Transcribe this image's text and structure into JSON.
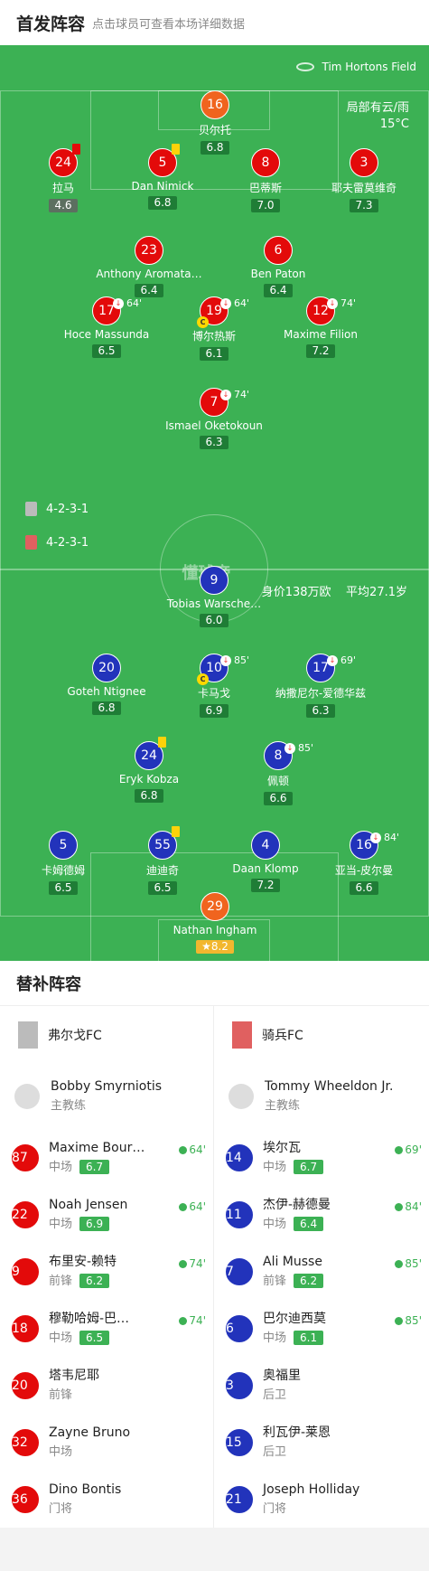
{
  "header": {
    "title": "首发阵容",
    "subtitle": "点击球员可查看本场详细数据"
  },
  "match": {
    "venue": "Tim Hortons Field",
    "weather": "局部有云/雨",
    "temp": "15°C"
  },
  "home": {
    "formation": "4-2-3-1",
    "players": [
      {
        "num": "16",
        "name": "贝尔托",
        "rating": "6.8",
        "gk": true
      },
      {
        "num": "24",
        "name": "拉马",
        "rating": "4.6",
        "card": "red",
        "low": true
      },
      {
        "num": "5",
        "name": "Dan Nimick",
        "rating": "6.8",
        "card": "yellow"
      },
      {
        "num": "8",
        "name": "巴蒂斯",
        "rating": "7.0"
      },
      {
        "num": "3",
        "name": "耶夫雷莫维奇",
        "rating": "7.3"
      },
      {
        "num": "23",
        "name": "Anthony Aromata…",
        "rating": "6.4"
      },
      {
        "num": "6",
        "name": "Ben Paton",
        "rating": "6.4"
      },
      {
        "num": "17",
        "name": "Hoce Massunda",
        "rating": "6.5",
        "sub": "64'"
      },
      {
        "num": "19",
        "name": "博尔热斯",
        "rating": "6.1",
        "sub": "64'",
        "captain": true
      },
      {
        "num": "12",
        "name": "Maxime Filion",
        "rating": "7.2",
        "sub": "74'"
      },
      {
        "num": "7",
        "name": "Ismael Oketokoun",
        "rating": "6.3",
        "sub": "74'"
      }
    ]
  },
  "away": {
    "formation": "4-2-3-1",
    "value": "身价138万欧",
    "age": "平均27.1岁",
    "players": [
      {
        "num": "9",
        "name": "Tobias Warsche…",
        "rating": "6.0"
      },
      {
        "num": "20",
        "name": "Goteh Ntignee",
        "rating": "6.8"
      },
      {
        "num": "10",
        "name": "卡马戈",
        "rating": "6.9",
        "sub": "85'",
        "captain": true
      },
      {
        "num": "17",
        "name": "纳撒尼尔-爱德华兹",
        "rating": "6.3",
        "sub": "69'"
      },
      {
        "num": "24",
        "name": "Eryk Kobza",
        "rating": "6.8",
        "card": "yellow"
      },
      {
        "num": "8",
        "name": "佩顿",
        "rating": "6.6",
        "sub": "85'"
      },
      {
        "num": "5",
        "name": "卡姆德姆",
        "rating": "6.5"
      },
      {
        "num": "55",
        "name": "迪迪奇",
        "rating": "6.5",
        "card": "yellow"
      },
      {
        "num": "4",
        "name": "Daan Klomp",
        "rating": "7.2"
      },
      {
        "num": "16",
        "name": "亚当-皮尔曼",
        "rating": "6.6",
        "sub": "84'"
      },
      {
        "num": "29",
        "name": "Nathan Ingham",
        "rating": "8.2",
        "gk": true,
        "star": true
      }
    ]
  },
  "logo": "懂球帝",
  "subs": {
    "title": "替补阵容",
    "home": {
      "team": "弗尔戈FC",
      "coach": "Bobby Smyrniotis",
      "coach_role": "主教练",
      "list": [
        {
          "num": "87",
          "name": "Maxime Bour…",
          "pos": "中场",
          "rating": "6.7",
          "time": "64'"
        },
        {
          "num": "22",
          "name": "Noah Jensen",
          "pos": "中场",
          "rating": "6.9",
          "time": "64'"
        },
        {
          "num": "9",
          "name": "布里安-赖特",
          "pos": "前锋",
          "rating": "6.2",
          "time": "74'"
        },
        {
          "num": "18",
          "name": "穆勒哈姆-巴…",
          "pos": "中场",
          "rating": "6.5",
          "time": "74'"
        },
        {
          "num": "20",
          "name": "塔韦尼耶",
          "pos": "前锋"
        },
        {
          "num": "32",
          "name": "Zayne Bruno",
          "pos": "中场"
        },
        {
          "num": "36",
          "name": "Dino Bontis",
          "pos": "门将"
        }
      ]
    },
    "away": {
      "team": "骑兵FC",
      "coach": "Tommy Wheeldon Jr.",
      "coach_role": "主教练",
      "list": [
        {
          "num": "14",
          "name": "埃尔瓦",
          "pos": "中场",
          "rating": "6.7",
          "time": "69'"
        },
        {
          "num": "11",
          "name": "杰伊-赫德曼",
          "pos": "中场",
          "rating": "6.4",
          "time": "84'"
        },
        {
          "num": "7",
          "name": "Ali Musse",
          "pos": "前锋",
          "rating": "6.2",
          "time": "85'"
        },
        {
          "num": "6",
          "name": "巴尔迪西莫",
          "pos": "中场",
          "rating": "6.1",
          "time": "85'"
        },
        {
          "num": "3",
          "name": "奥福里",
          "pos": "后卫"
        },
        {
          "num": "15",
          "name": "利瓦伊-莱恩",
          "pos": "后卫"
        },
        {
          "num": "21",
          "name": "Joseph Holliday",
          "pos": "门将"
        }
      ]
    }
  }
}
